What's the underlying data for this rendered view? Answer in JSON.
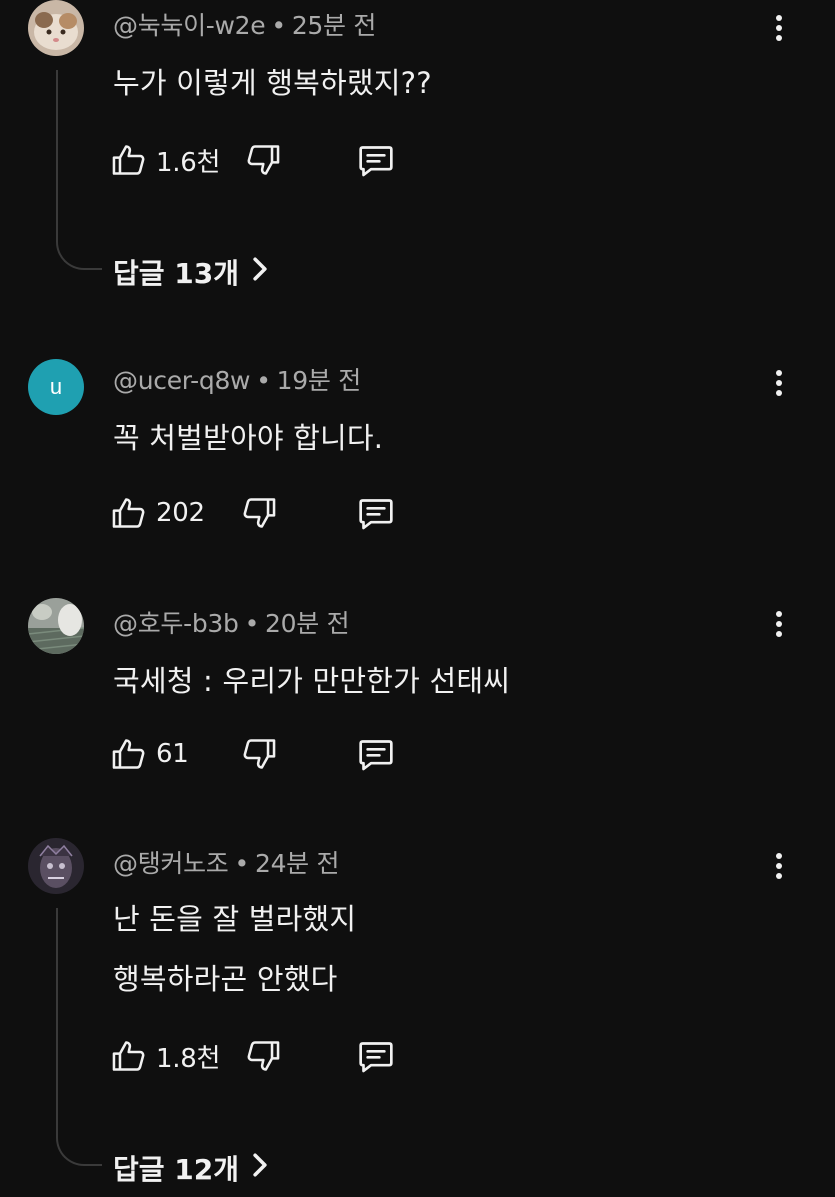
{
  "comments": [
    {
      "handle": "@눅눅이-w2e",
      "time": "25분 전",
      "lines": [
        "누가 이렇게 행복하랬지??"
      ],
      "likes": "1.6천",
      "avatar": {
        "kind": "image",
        "icon": "cat-photo-avatar"
      },
      "replies": "답글 13개"
    },
    {
      "handle": "@ucer-q8w",
      "time": "19분 전",
      "lines": [
        "꼭 처벌받아야 합니다."
      ],
      "likes": "202",
      "avatar": {
        "kind": "letter",
        "letter": "u",
        "color": "#1fa0b1"
      }
    },
    {
      "handle": "@호두-b3b",
      "time": "20분 전",
      "lines": [
        "국세청 : 우리가 만만한가 선태씨"
      ],
      "likes": "61",
      "avatar": {
        "kind": "image",
        "icon": "pet-photo-avatar"
      }
    },
    {
      "handle": "@탱커노조",
      "time": "24분 전",
      "lines": [
        "난 돈을 잘 벌라했지",
        "행복하라곤 안했다"
      ],
      "likes": "1.8천",
      "avatar": {
        "kind": "image",
        "icon": "character-photo-avatar"
      },
      "replies": "답글 12개"
    }
  ],
  "separator": "•",
  "icons": {
    "like": "thumbs-up-icon",
    "dislike": "thumbs-down-icon",
    "reply": "reply-comment-icon",
    "more": "more-vertical-icon",
    "chevron": "chevron-right-icon"
  },
  "colors": {
    "background": "#0f0f0f",
    "text": "#f1f1f1",
    "meta": "#aaaaaa"
  }
}
